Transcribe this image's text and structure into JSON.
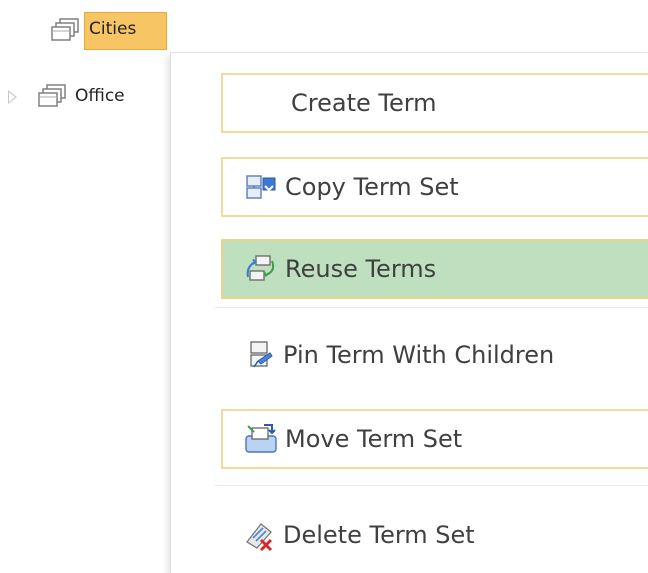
{
  "tree": {
    "nodes": [
      {
        "label": "Cities",
        "selected": true,
        "expandable": false,
        "icon": "term-set-stack-icon"
      },
      {
        "label": "Office",
        "selected": false,
        "expandable": true,
        "icon": "term-set-stack-icon"
      }
    ]
  },
  "menu": {
    "items": [
      {
        "label": "Create Term",
        "icon": ""
      },
      {
        "label": "Copy Term Set",
        "icon": "copy-term-set-icon"
      },
      {
        "label": "Reuse Terms",
        "icon": "reuse-terms-icon"
      },
      {
        "label": "Pin Term With Children",
        "icon": "pin-term-icon"
      },
      {
        "label": "Move Term Set",
        "icon": "move-term-set-icon"
      },
      {
        "label": "Delete Term Set",
        "icon": "delete-term-set-icon"
      }
    ],
    "highlighted": "Reuse Terms"
  },
  "colors": {
    "selected_node_bg": "#f7c564",
    "hover_item_bg": "#bfe0bf",
    "item_border": "#f0dd9a",
    "text": "#404040"
  }
}
